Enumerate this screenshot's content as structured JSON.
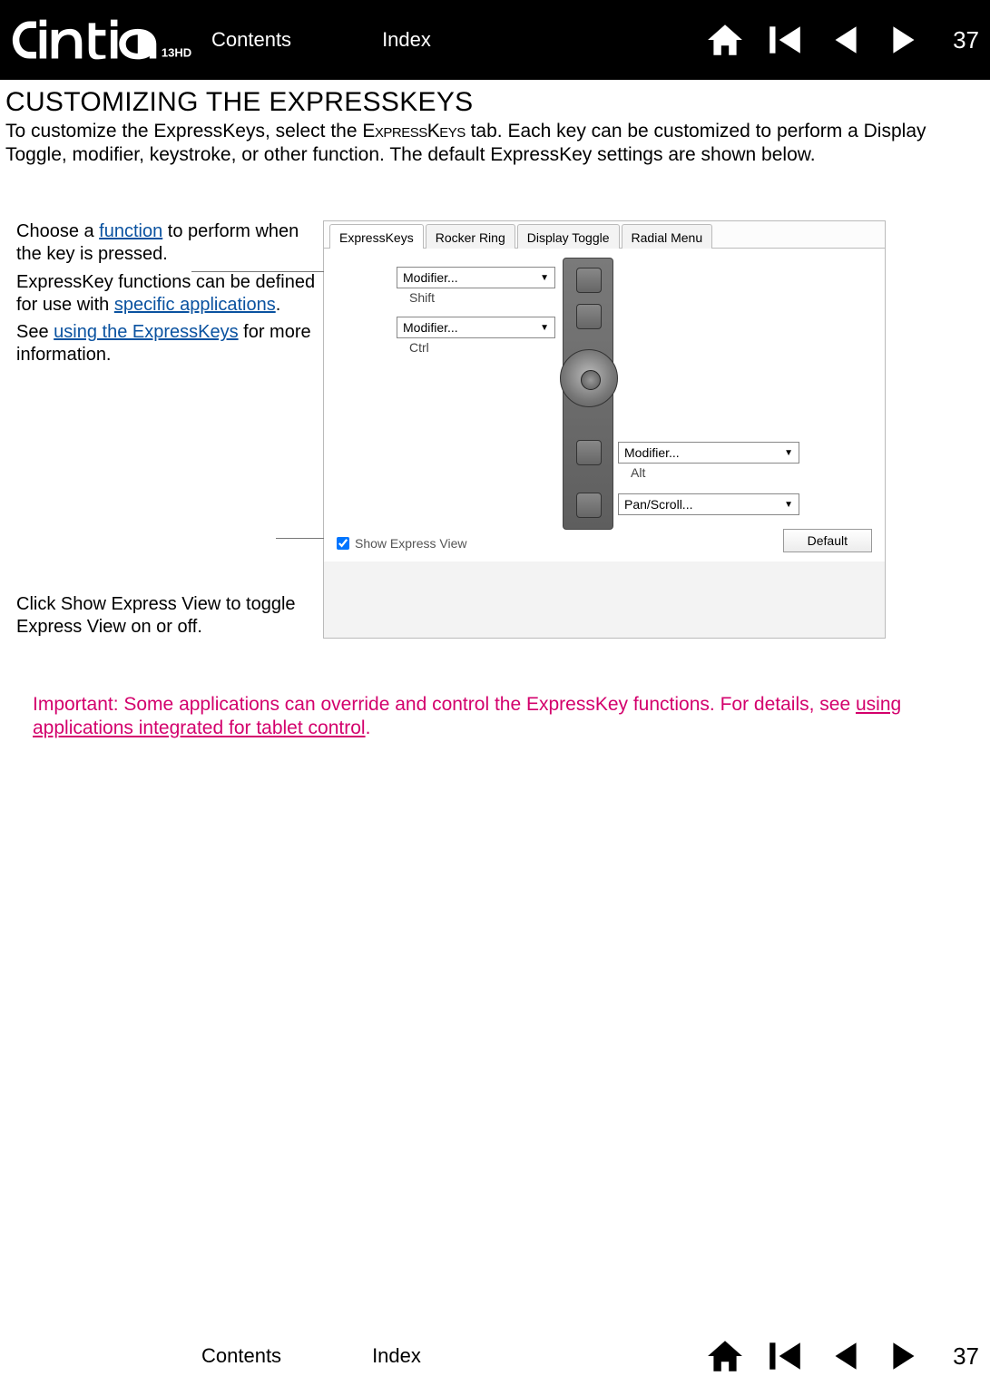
{
  "header": {
    "product": "intiq",
    "model": "13HD",
    "page_number": "37",
    "links": {
      "contents": "Contents",
      "index": "Index"
    }
  },
  "section": {
    "title": "CUSTOMIZING THE EXPRESSKEYS",
    "intro_before": "To customize the ExpressKeys, select the ",
    "intro_tab_smallcaps_1": "Express",
    "intro_tab_smallcaps_2": "Keys",
    "intro_after": " tab. Each key can be customized to perform a Display Toggle, modifier, keystroke, or other function. The default ExpressKey settings are shown below."
  },
  "annot": {
    "line1_a": "Choose a ",
    "line1_link": "function",
    "line1_b": " to perform when the key is pressed.",
    "line2_a": "ExpressKey functions can be defined for use with ",
    "line2_link": "specific applications",
    "line2_b": ".",
    "line3_a": "See ",
    "line3_link": "using the ExpressKeys",
    "line3_b": " for more information.",
    "show_ev": "Click Show Express View to toggle Express View on or off."
  },
  "panel": {
    "tabs": [
      "ExpressKeys",
      "Rocker Ring",
      "Display Toggle",
      "Radial Menu"
    ],
    "dd1": {
      "label": "Modifier...",
      "sub": "Shift"
    },
    "dd2": {
      "label": "Modifier...",
      "sub": "Ctrl"
    },
    "dd3": {
      "label": "Modifier...",
      "sub": "Alt"
    },
    "dd4": {
      "label": "Pan/Scroll..."
    },
    "show_express_view": "Show Express View",
    "default_button": "Default"
  },
  "important": {
    "prefix": "Important: Some applications can override and control the ExpressKey functions. For details, see ",
    "link": "using applications integrated for tablet control",
    "suffix": "."
  },
  "footer": {
    "page_number": "37",
    "links": {
      "contents": "Contents",
      "index": "Index"
    }
  }
}
